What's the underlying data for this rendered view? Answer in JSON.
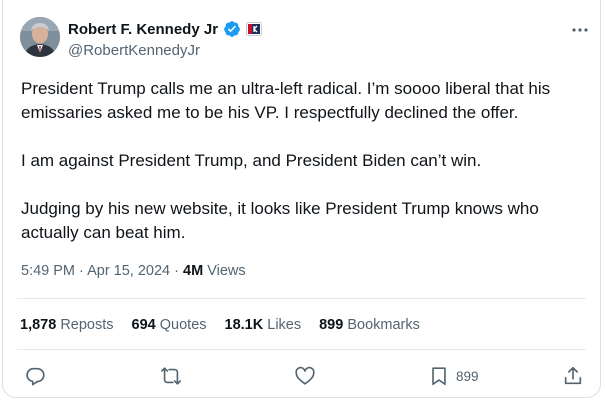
{
  "author": {
    "name": "Robert F. Kennedy Jr",
    "handle": "@RobertKennedyJr"
  },
  "tweet": {
    "text": "President Trump calls me an ultra-left radical. I’m soooo liberal that his\nemissaries asked me to be his VP. I respectfully declined the offer.\n\nI am against President Trump, and President Biden can’t win.\n\nJudging by his new website, it looks like President Trump knows who\nactually can beat him.",
    "time": "5:49 PM · Apr 15, 2024 · ",
    "views_count": "4M",
    "views_label": " Views"
  },
  "stats": {
    "reposts_count": "1,878",
    "reposts_label": "Reposts",
    "quotes_count": "694",
    "quotes_label": "Quotes",
    "likes_count": "18.1K",
    "likes_label": "Likes",
    "bookmarks_count": "899",
    "bookmarks_label": "Bookmarks"
  },
  "actions": {
    "bookmark_count": "899"
  },
  "colors": {
    "text": "#0f1419",
    "secondary": "#536471",
    "verified": "#1d9bf0",
    "divider": "#e6e9ec"
  },
  "icons": [
    "verified-icon",
    "campaign-badge-icon",
    "more-icon",
    "reply-icon",
    "repost-icon",
    "like-icon",
    "bookmark-icon",
    "share-icon"
  ]
}
